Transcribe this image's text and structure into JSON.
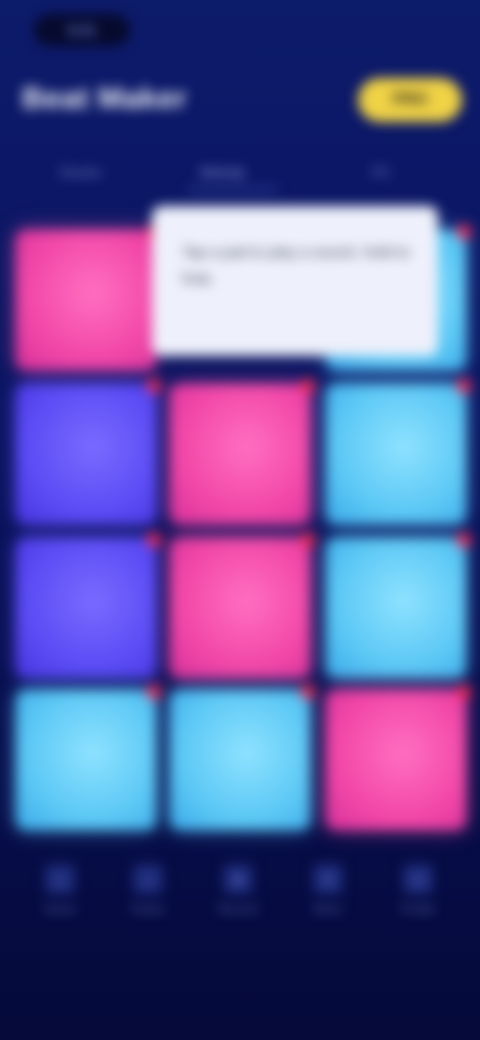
{
  "status": {
    "time": "9:41"
  },
  "header": {
    "title": "Beat Maker",
    "action_label": "PRO"
  },
  "tabs": [
    {
      "label": "Drums"
    },
    {
      "label": "Melody"
    },
    {
      "label": "FX"
    }
  ],
  "tooltip": {
    "text": "Tap a pad to play a sound. Hold to loop."
  },
  "pads": {
    "colors": {
      "pink": "#f247a8",
      "violet": "#5b4cf5",
      "cyan": "#5cc8f5"
    }
  },
  "bottom_nav": [
    {
      "icon": "home-icon",
      "label": "Home"
    },
    {
      "icon": "music-icon",
      "label": "Packs"
    },
    {
      "icon": "record-icon",
      "label": "Record"
    },
    {
      "icon": "mixer-icon",
      "label": "Mixer"
    },
    {
      "icon": "user-icon",
      "label": "Profile"
    }
  ]
}
